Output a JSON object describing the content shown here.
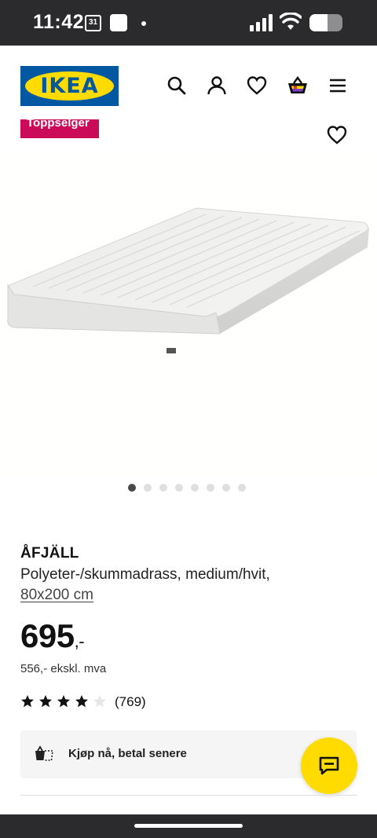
{
  "status_bar": {
    "time": "11:42",
    "calendar_day": "31",
    "battery_level": 0.55
  },
  "header": {
    "logo_text": "IKEA",
    "icons": [
      "search-icon",
      "account-icon",
      "favourites-icon",
      "shopping-bag-icon",
      "menu-icon"
    ]
  },
  "badge": {
    "label": "Toppselger"
  },
  "gallery": {
    "image_count": 8,
    "active_index": 0
  },
  "product": {
    "name": "ÅFJÄLL",
    "description": "Polyeter-/skummadrass, medium/hvit,",
    "size": "80x200 cm",
    "price_main": "695",
    "price_suffix": ",-",
    "price_ex_vat": "556,- ekskl. mva",
    "rating": 4,
    "rating_max": 5,
    "review_count": "(769)"
  },
  "pay_later": {
    "label": "Kjøp nå, betal senere"
  },
  "colors": {
    "ikea_blue": "#0058a3",
    "ikea_yellow": "#ffdb00",
    "badge_red": "#cc0a5a"
  }
}
